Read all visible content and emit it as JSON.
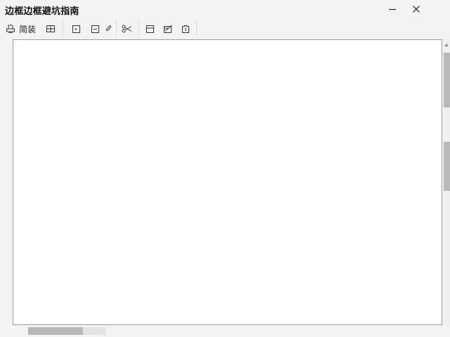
{
  "window": {
    "title": "边框边框避坑指南"
  },
  "titlebar_buttons": {
    "minimize_icon": "minimize-icon",
    "close_icon": "close-icon"
  },
  "toolbar": {
    "groups": [
      {
        "items": [
          {
            "icon": "print-icon",
            "label": "简装"
          },
          {
            "icon": "layout-icon",
            "label": ""
          }
        ]
      },
      {
        "items": [
          {
            "icon": "insert-frame-icon",
            "label": ""
          },
          {
            "icon": "minus-frame-icon",
            "label": ""
          },
          {
            "icon": "brush-icon",
            "label": ""
          }
        ]
      },
      {
        "items": [
          {
            "icon": "scissors-icon",
            "label": ""
          }
        ]
      },
      {
        "items": [
          {
            "icon": "frame-icon",
            "label": ""
          },
          {
            "icon": "edit-frame-icon",
            "label": ""
          },
          {
            "icon": "info-frame-icon",
            "label": ""
          }
        ]
      }
    ]
  },
  "colors": {
    "background": "#f3f3f3",
    "canvas": "#ffffff",
    "scrollbar_thumb": "#b9b9b9"
  }
}
